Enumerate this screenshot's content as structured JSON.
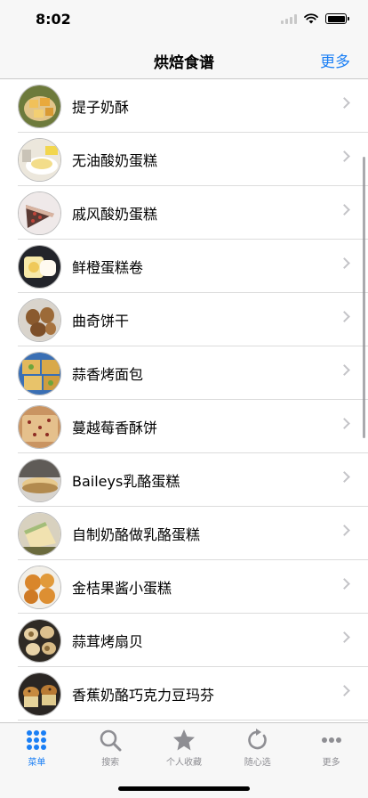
{
  "status": {
    "time": "8:02"
  },
  "nav": {
    "title": "烘焙食谱",
    "more_label": "更多"
  },
  "recipes": [
    {
      "label": "提子奶酥",
      "thumb": "cream-pastry-thumb"
    },
    {
      "label": "无油酸奶蛋糕",
      "thumb": "yogurt-cake-thumb"
    },
    {
      "label": "戚风酸奶蛋糕",
      "thumb": "chiffon-cake-thumb"
    },
    {
      "label": "鲜橙蛋糕卷",
      "thumb": "orange-roll-thumb"
    },
    {
      "label": "曲奇饼干",
      "thumb": "cookie-thumb"
    },
    {
      "label": "蒜香烤面包",
      "thumb": "garlic-bread-thumb"
    },
    {
      "label": "蔓越莓香酥饼",
      "thumb": "cranberry-biscuit-thumb"
    },
    {
      "label": "Baileys乳酪蛋糕",
      "thumb": "baileys-cake-thumb"
    },
    {
      "label": "自制奶酪做乳酪蛋糕",
      "thumb": "cheesecake-thumb"
    },
    {
      "label": "金桔果酱小蛋糕",
      "thumb": "kumquat-cake-thumb"
    },
    {
      "label": "蒜茸烤扇贝",
      "thumb": "scallop-thumb"
    },
    {
      "label": "香蕉奶酪巧克力豆玛芬",
      "thumb": "muffin-thumb"
    }
  ],
  "tabs": [
    {
      "label": "菜单",
      "icon": "grid-icon",
      "active": true
    },
    {
      "label": "搜索",
      "icon": "search-icon",
      "active": false
    },
    {
      "label": "个人收藏",
      "icon": "star-icon",
      "active": false
    },
    {
      "label": "随心选",
      "icon": "refresh-icon",
      "active": false
    },
    {
      "label": "更多",
      "icon": "more-icon",
      "active": false
    }
  ],
  "colors": {
    "accent": "#1a7ff5",
    "inactive": "#8e8e93",
    "bar_bg": "#f7f7f7"
  }
}
